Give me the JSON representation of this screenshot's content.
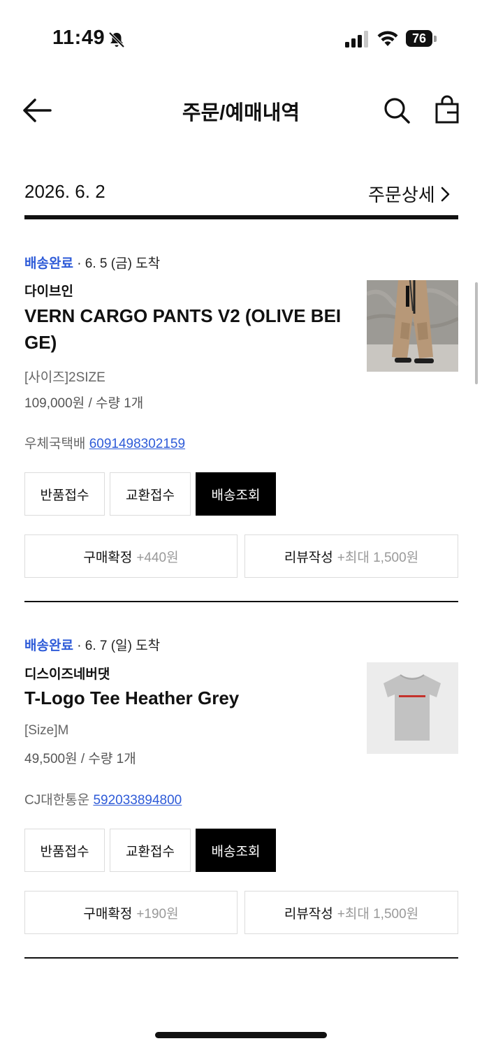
{
  "status_bar": {
    "time": "11:49",
    "battery": "76"
  },
  "header": {
    "title": "주문/예매내역"
  },
  "order": {
    "date": "2026. 6. 2",
    "detail_link": "주문상세"
  },
  "items": [
    {
      "status": "배송완료",
      "arrival": " · 6. 5 (금) 도착",
      "brand": "다이브인",
      "name": "VERN CARGO PANTS V2 (OLIVE BEIGE)",
      "option": "[사이즈]2SIZE",
      "price_qty": "109,000원 / 수량 1개",
      "courier": "우체국택배",
      "tracking": "6091498302159",
      "buttons": {
        "return": "반품접수",
        "exchange": "교환접수",
        "track": "배송조회"
      },
      "confirm": {
        "label": "구매확정",
        "points": "+440원"
      },
      "review": {
        "label": "리뷰작성",
        "points": "+최대 1,500원"
      }
    },
    {
      "status": "배송완료",
      "arrival": " · 6. 7 (일) 도착",
      "brand": "디스이즈네버댓",
      "name": "T-Logo Tee Heather Grey",
      "option": "[Size]M",
      "price_qty": "49,500원 / 수량 1개",
      "courier": "CJ대한통운",
      "tracking": "592033894800",
      "buttons": {
        "return": "반품접수",
        "exchange": "교환접수",
        "track": "배송조회"
      },
      "confirm": {
        "label": "구매확정",
        "points": "+190원"
      },
      "review": {
        "label": "리뷰작성",
        "points": "+최대 1,500원"
      }
    }
  ],
  "colors": {
    "status_blue": "#2e5bd8",
    "dark_button": "#000000"
  },
  "icons": [
    "bell-slash-icon",
    "cellular-signal-icon",
    "wifi-icon",
    "battery-icon",
    "back-arrow-icon",
    "search-icon",
    "shopping-bag-icon",
    "chevron-right-icon"
  ]
}
